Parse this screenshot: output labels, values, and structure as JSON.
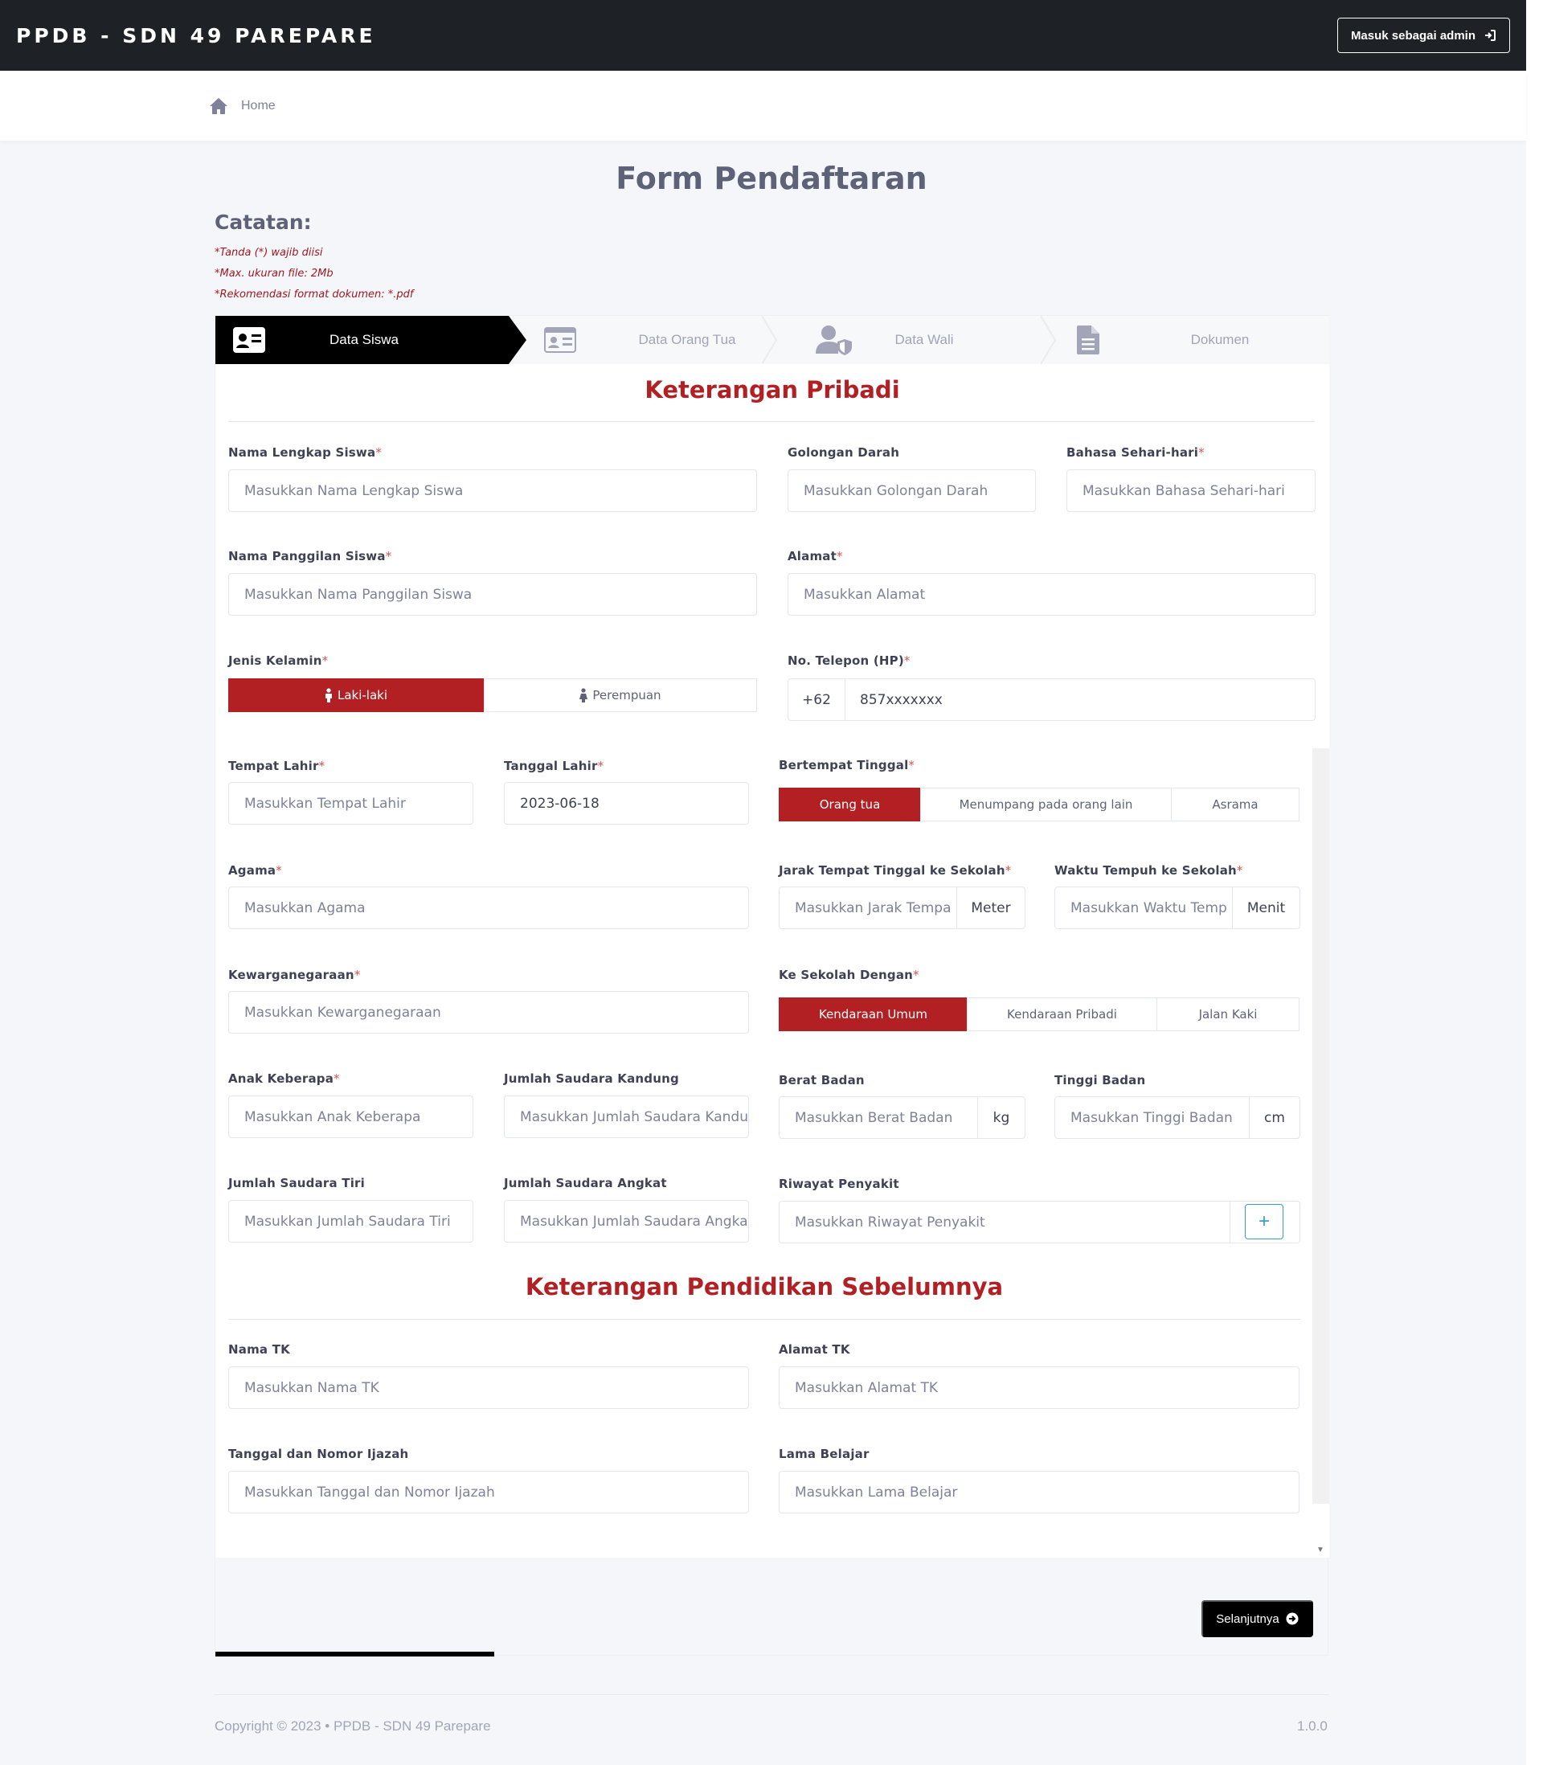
{
  "nav": {
    "brand": "PPDB - SDN 49 PAREPARE",
    "admin_button": "Masuk sebagai admin"
  },
  "breadcrumb": {
    "home": "Home"
  },
  "page": {
    "title": "Form Pendaftaran",
    "notes_title": "Catatan:",
    "notes": [
      "*Tanda (*) wajib diisi",
      "*Max. ukuran file: 2Mb",
      "*Rekomendasi format dokumen: *.pdf"
    ]
  },
  "steps": [
    "Data Siswa",
    "Data Orang Tua",
    "Data Wali",
    "Dokumen"
  ],
  "section_personal": "Keterangan Pribadi",
  "section_education": "Keterangan Pendidikan Sebelumnya",
  "fields": {
    "nama_lengkap": {
      "label": "Nama Lengkap Siswa",
      "placeholder": "Masukkan Nama Lengkap Siswa"
    },
    "golongan_darah": {
      "label": "Golongan Darah",
      "placeholder": "Masukkan Golongan Darah"
    },
    "bahasa": {
      "label": "Bahasa Sehari-hari",
      "placeholder": "Masukkan Bahasa Sehari-hari"
    },
    "nama_panggilan": {
      "label": "Nama Panggilan Siswa",
      "placeholder": "Masukkan Nama Panggilan Siswa"
    },
    "alamat": {
      "label": "Alamat",
      "placeholder": "Masukkan Alamat"
    },
    "jenis_kelamin": {
      "label": "Jenis Kelamin",
      "options": [
        "Laki-laki",
        "Perempuan"
      ],
      "selected": "Laki-laki"
    },
    "telepon": {
      "label": "No. Telepon (HP)",
      "prefix": "+62",
      "placeholder": "857xxxxxxx"
    },
    "tempat_lahir": {
      "label": "Tempat Lahir",
      "placeholder": "Masukkan Tempat Lahir"
    },
    "tanggal_lahir": {
      "label": "Tanggal Lahir",
      "value": "2023-06-18"
    },
    "bertempat_tinggal": {
      "label": "Bertempat Tinggal",
      "options": [
        "Orang tua",
        "Menumpang pada orang lain",
        "Asrama"
      ],
      "selected": "Orang tua"
    },
    "agama": {
      "label": "Agama",
      "placeholder": "Masukkan Agama"
    },
    "jarak": {
      "label": "Jarak Tempat Tinggal ke Sekolah",
      "placeholder": "Masukkan Jarak Tempa",
      "unit": "Meter"
    },
    "waktu": {
      "label": "Waktu Tempuh ke Sekolah",
      "placeholder": "Masukkan Waktu Temp",
      "unit": "Menit"
    },
    "kewarganegaraan": {
      "label": "Kewarganegaraan",
      "placeholder": "Masukkan Kewarganegaraan"
    },
    "ke_sekolah": {
      "label": "Ke Sekolah Dengan",
      "options": [
        "Kendaraan Umum",
        "Kendaraan Pribadi",
        "Jalan Kaki"
      ],
      "selected": "Kendaraan Umum"
    },
    "anak_keberapa": {
      "label": "Anak Keberapa",
      "placeholder": "Masukkan Anak Keberapa"
    },
    "saudara_kandung": {
      "label": "Jumlah Saudara Kandung",
      "placeholder": "Masukkan Jumlah Saudara Kandu"
    },
    "berat_badan": {
      "label": "Berat Badan",
      "placeholder": "Masukkan Berat Badan",
      "unit": "kg"
    },
    "tinggi_badan": {
      "label": "Tinggi Badan",
      "placeholder": "Masukkan Tinggi Badan",
      "unit": "cm"
    },
    "saudara_tiri": {
      "label": "Jumlah Saudara Tiri",
      "placeholder": "Masukkan Jumlah Saudara Tiri"
    },
    "saudara_angkat": {
      "label": "Jumlah Saudara Angkat",
      "placeholder": "Masukkan Jumlah Saudara Angkat"
    },
    "riwayat_penyakit": {
      "label": "Riwayat Penyakit",
      "placeholder": "Masukkan Riwayat Penyakit",
      "add_button": "+"
    },
    "nama_tk": {
      "label": "Nama TK",
      "placeholder": "Masukkan Nama TK"
    },
    "alamat_tk": {
      "label": "Alamat TK",
      "placeholder": "Masukkan Alamat TK"
    },
    "ijazah": {
      "label": "Tanggal dan Nomor Ijazah",
      "placeholder": "Masukkan Tanggal dan Nomor Ijazah"
    },
    "lama_belajar": {
      "label": "Lama Belajar",
      "placeholder": "Masukkan Lama Belajar"
    }
  },
  "required_mark": "*",
  "next_button": "Selanjutnya",
  "footer": {
    "copyright": "Copyright © 2023  •  PPDB - SDN 49 Parepare",
    "version": "1.0.0"
  },
  "colors": {
    "accent": "#b22024",
    "nav_bg": "#1e2125",
    "step_active": "#000000"
  },
  "progress": {
    "fraction": 0.25
  }
}
